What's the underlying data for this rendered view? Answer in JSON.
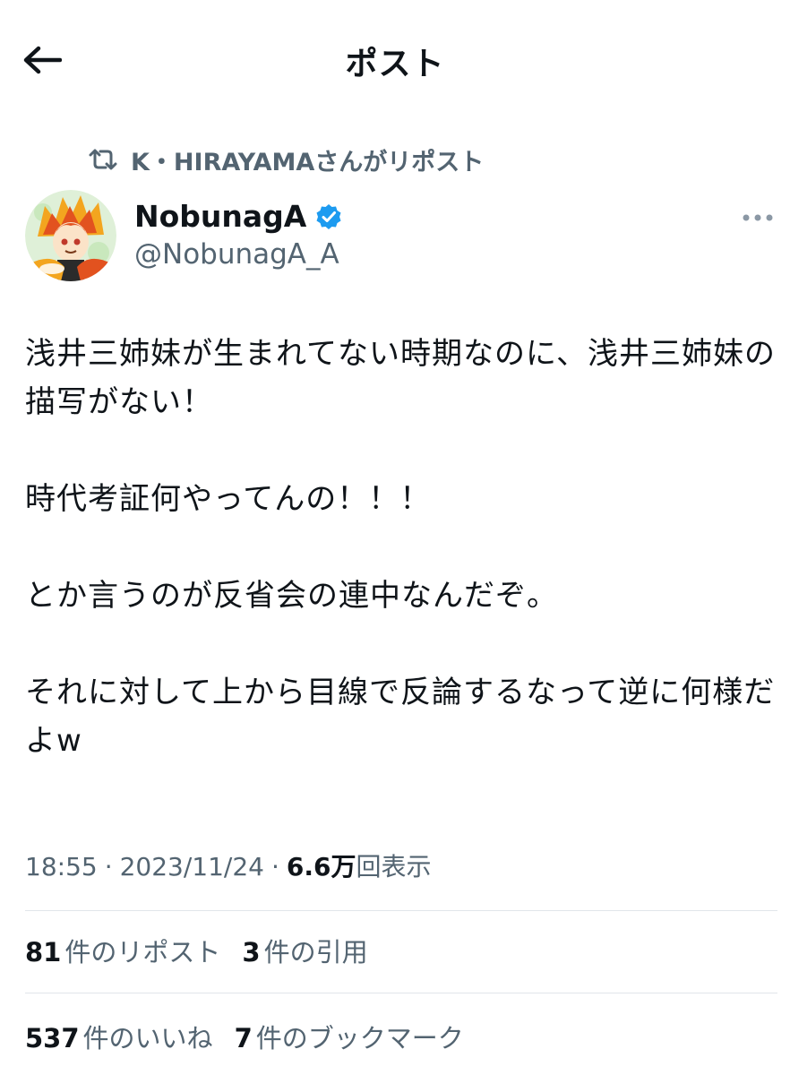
{
  "header": {
    "title": "ポスト"
  },
  "repost": {
    "text": "K・HIRAYAMAさんがリポスト"
  },
  "author": {
    "display_name": "NobunagA",
    "handle": "@NobunagA_A"
  },
  "tweet": {
    "paragraphs": [
      "浅井三姉妹が生まれてない時期なのに、浅井三姉妹の描写がない！",
      "時代考証何やってんの！！！",
      "とか言うのが反省会の連中なんだぞ。",
      "それに対して上から目線で反論するなって逆に何様だよw"
    ]
  },
  "meta": {
    "time": "18:55",
    "sep1": "·",
    "date": "2023/11/24",
    "sep2": "·",
    "views_count": "6.6万",
    "views_label": "回表示"
  },
  "stats": {
    "reposts_count": "81",
    "reposts_label": "件のリポスト",
    "quotes_count": "3",
    "quotes_label": "件の引用",
    "likes_count": "537",
    "likes_label": "件のいいね",
    "bookmarks_count": "7",
    "bookmarks_label": "件のブックマーク"
  },
  "icons": {
    "back": "arrow-left-icon",
    "repost": "repost-icon",
    "verified": "verified-badge-icon",
    "more": "more-dots-icon"
  },
  "colors": {
    "text": "#0f1419",
    "secondary": "#536471",
    "verified": "#1d9bf0",
    "divider": "#e1e6ea"
  }
}
